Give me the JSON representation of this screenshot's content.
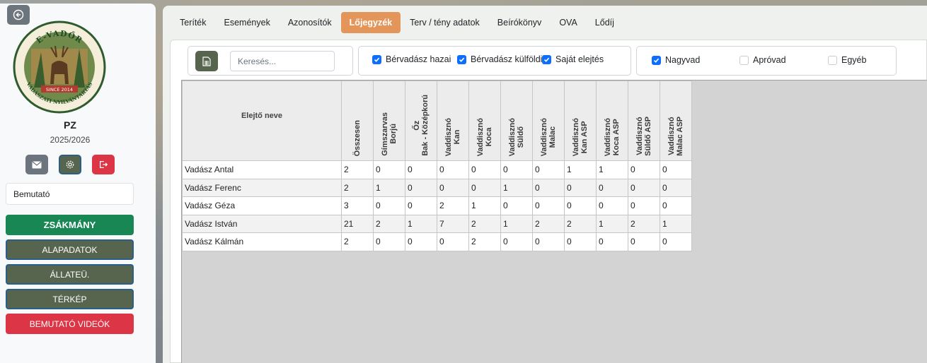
{
  "sidebar": {
    "logo": {
      "top_text": "E-VADŐR",
      "ribbon_text": "SINCE 2014",
      "bottom_text": "VADÁSZATI NYILVÁNTARTÁS"
    },
    "user": "PZ",
    "season": "2025/2026",
    "organization": "Bemutató",
    "menu": [
      {
        "label": "ZSÁKMÁNY",
        "style": "green"
      },
      {
        "label": "ALAPADATOK",
        "style": "olive"
      },
      {
        "label": "ÁLLATEÜ.",
        "style": "olive"
      },
      {
        "label": "TÉRKÉP",
        "style": "olive"
      },
      {
        "label": "BEMUTATÓ VIDEÓK",
        "style": "red"
      }
    ]
  },
  "tabs": [
    {
      "label": "Teríték"
    },
    {
      "label": "Események"
    },
    {
      "label": "Azonosítók"
    },
    {
      "label": "Lőjegyzék",
      "active": true
    },
    {
      "label": "Terv / tény adatok"
    },
    {
      "label": "Beírókönyv"
    },
    {
      "label": "OVA"
    },
    {
      "label": "Lődíj"
    }
  ],
  "filters": {
    "search_placeholder": "Keresés...",
    "group1": [
      {
        "label": "Bérvadász hazai",
        "checked": true
      },
      {
        "label": "Bérvadász külföldi",
        "checked": true
      },
      {
        "label": "Saját elejtés",
        "checked": true
      }
    ],
    "group2": [
      {
        "label": "Nagyvad",
        "checked": true
      },
      {
        "label": "Apróvad",
        "checked": false
      },
      {
        "label": "Egyéb",
        "checked": false
      }
    ]
  },
  "table": {
    "name_header": "Elejtő neve",
    "columns": [
      "Összesen",
      "Gímszarvas\nBorjú",
      "Őz\nBak - Középkorú",
      "Vaddisznó\nKan",
      "Vaddisznó\nKoca",
      "Vaddisznó\nSüldő",
      "Vaddisznó\nMalac",
      "Vaddisznó\nKan ASP",
      "Vaddisznó\nKoca ASP",
      "Vaddisznó\nSüldő ASP",
      "Vaddisznó\nMalac ASP"
    ],
    "rows": [
      {
        "name": "Vadász Antal",
        "values": [
          "2",
          "0",
          "0",
          "0",
          "0",
          "0",
          "0",
          "1",
          "1",
          "0",
          "0"
        ]
      },
      {
        "name": "Vadász Ferenc",
        "values": [
          "2",
          "1",
          "0",
          "0",
          "0",
          "1",
          "0",
          "0",
          "0",
          "0",
          "0"
        ]
      },
      {
        "name": "Vadász Géza",
        "values": [
          "3",
          "0",
          "0",
          "2",
          "1",
          "0",
          "0",
          "0",
          "0",
          "0",
          "0"
        ]
      },
      {
        "name": "Vadász István",
        "values": [
          "21",
          "2",
          "1",
          "7",
          "2",
          "1",
          "2",
          "2",
          "1",
          "2",
          "1"
        ]
      },
      {
        "name": "Vadász Kálmán",
        "values": [
          "2",
          "0",
          "0",
          "0",
          "2",
          "0",
          "0",
          "0",
          "0",
          "0",
          "0"
        ]
      }
    ]
  },
  "colors": {
    "accent_tab": "#e4955a",
    "olive": "#57654f",
    "green": "#198754",
    "red": "#dc3545",
    "checkbox": "#0d6efd"
  }
}
